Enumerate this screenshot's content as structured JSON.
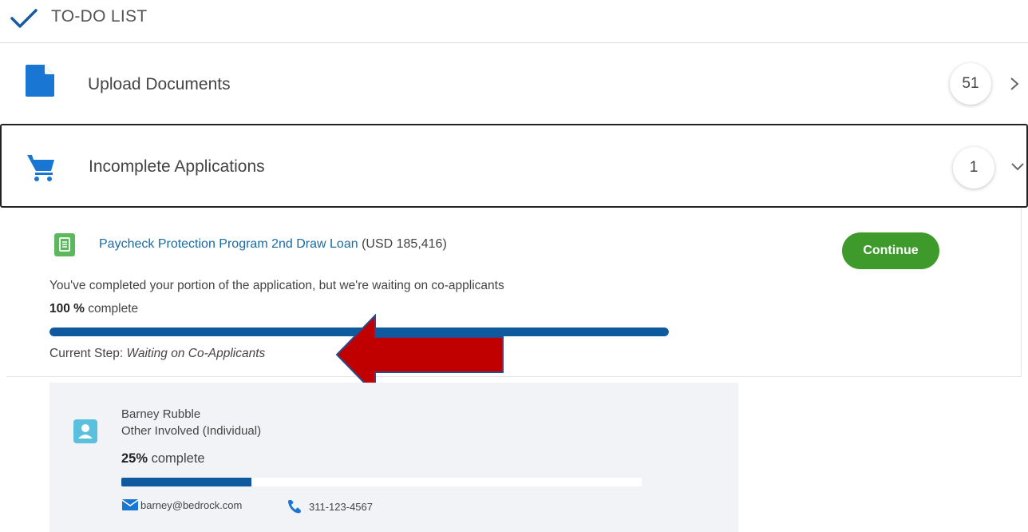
{
  "header": {
    "title": "TO-DO LIST",
    "icon": "checkmark-icon",
    "accent": "#1a5aa0"
  },
  "rows": {
    "upload": {
      "label": "Upload Documents",
      "count": "51",
      "icon": "document-icon",
      "chevron": "chevron-right-icon"
    },
    "incomplete": {
      "label": "Incomplete Applications",
      "count": "1",
      "icon": "cart-icon",
      "chevron": "chevron-down-icon"
    }
  },
  "application": {
    "loan_name": "Paycheck Protection Program 2nd Draw Loan",
    "loan_amount": "(USD 185,416)",
    "continue_label": "Continue",
    "status_message": "You've completed your portion of the application, but we're waiting on co-applicants",
    "percent": "100 %",
    "percent_suffix": "complete",
    "progress": 1.0,
    "step_label": "Current Step:",
    "step_value": "Waiting on Co-Applicants",
    "progress_color": "#0f5a9e",
    "button_color": "#3e9a2b"
  },
  "annotation": {
    "arrow_color": "#c00000"
  },
  "co_applicant": {
    "name": "Barney Rubble",
    "role": "Other Involved (Individual)",
    "percent": "25%",
    "percent_suffix": "complete",
    "progress": 0.25,
    "email": "barney@bedrock.com",
    "phone": "311-123-4567"
  }
}
